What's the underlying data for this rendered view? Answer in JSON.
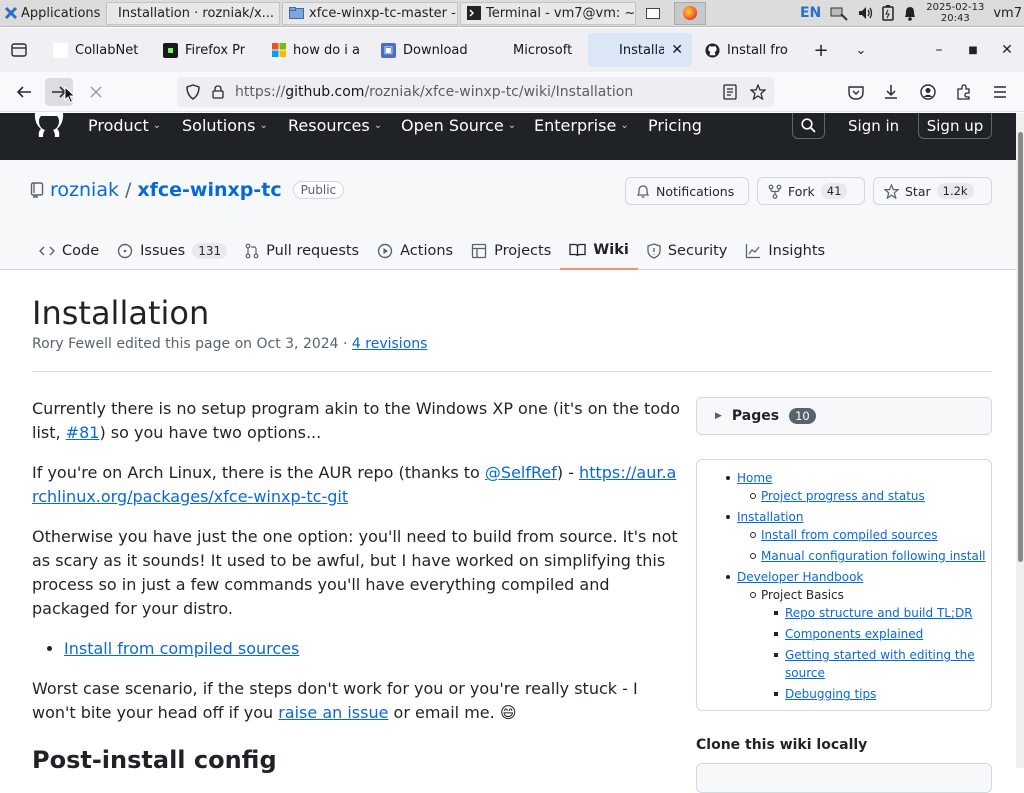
{
  "taskbar": {
    "apps_label": "Applications",
    "windows": [
      {
        "label": "Installation · rozniak/x...",
        "active": false
      },
      {
        "label": "xfce-winxp-tc-master -...",
        "active": false
      },
      {
        "label": "Terminal - vm7@vm: ~...",
        "active": false
      }
    ],
    "lang": "EN",
    "date": "2025-02-13",
    "time": "20:43",
    "user": "vm7"
  },
  "browser": {
    "tabs": [
      {
        "label": "CollabNet",
        "favicon": "page-icon"
      },
      {
        "label": "Firefox Pr",
        "favicon": "firefox-icon"
      },
      {
        "label": "how do i a",
        "favicon": "microsoft-icon"
      },
      {
        "label": "Download",
        "favicon": "download-icon"
      },
      {
        "label": "Microsoft",
        "favicon": "blank-icon"
      },
      {
        "label": "Installat",
        "favicon": "blank-icon",
        "active": true
      },
      {
        "label": "Install fro",
        "favicon": "github-icon"
      }
    ],
    "url_prefix": "https://",
    "url_host": "github.com",
    "url_path": "/rozniak/xfce-winxp-tc/wiki/Installation"
  },
  "github": {
    "nav": [
      {
        "label": "Product",
        "chevron": true
      },
      {
        "label": "Solutions",
        "chevron": true
      },
      {
        "label": "Resources",
        "chevron": true
      },
      {
        "label": "Open Source",
        "chevron": true
      },
      {
        "label": "Enterprise",
        "chevron": true
      },
      {
        "label": "Pricing",
        "chevron": false
      }
    ],
    "sign_in": "Sign in",
    "sign_up": "Sign up"
  },
  "repo": {
    "owner": "rozniak",
    "separator": "/",
    "name": "xfce-winxp-tc",
    "visibility": "Public",
    "notifications_label": "Notifications",
    "fork_label": "Fork",
    "fork_count": "41",
    "star_label": "Star",
    "star_count": "1.2k",
    "tabs": [
      {
        "label": "Code",
        "icon": "code-icon"
      },
      {
        "label": "Issues",
        "icon": "issue-icon",
        "count": "131"
      },
      {
        "label": "Pull requests",
        "icon": "pull-request-icon"
      },
      {
        "label": "Actions",
        "icon": "play-icon"
      },
      {
        "label": "Projects",
        "icon": "table-icon"
      },
      {
        "label": "Wiki",
        "icon": "book-icon",
        "selected": true
      },
      {
        "label": "Security",
        "icon": "shield-icon"
      },
      {
        "label": "Insights",
        "icon": "graph-icon"
      }
    ]
  },
  "page": {
    "title": "Installation",
    "meta_prefix": "Rory Fewell edited this page on Oct 3, 2024 · ",
    "revisions": "4 revisions",
    "p1_a": "Currently there is no setup program akin to the Windows XP one (it's on the todo list, ",
    "p1_link": "#81",
    "p1_b": ") so you have two options...",
    "p2_a": "If you're on Arch Linux, there is the AUR repo (thanks to ",
    "p2_link_user": "@SelfRef",
    "p2_b": ") - ",
    "p2_link_url": "https://aur.archlinux.org/packages/xfce-winxp-tc-git",
    "p3": "Otherwise you have just the one option: you'll need to build from source. It's not as scary as it sounds! It used to be awful, but I have worked on simplifying this process so in just a few commands you'll have everything compiled and packaged for your distro.",
    "list_link": "Install from compiled sources",
    "p4_a": "Worst case scenario, if the steps don't work for you or you're really stuck - I won't bite your head off if you ",
    "p4_link": "raise an issue",
    "p4_b": " or email me. ",
    "emoji": "😄",
    "h2": "Post-install config"
  },
  "sidebar": {
    "pages_label": "Pages",
    "pages_count": "10",
    "toc": {
      "home": "Home",
      "progress": "Project progress and status",
      "installation": "Installation",
      "install_compiled": "Install from compiled sources",
      "manual_config": "Manual configuration following install",
      "dev_handbook": "Developer Handbook",
      "project_basics": "Project Basics",
      "repo_structure": "Repo structure and build TL;DR",
      "components": "Components explained",
      "getting_started_1": "Getting started with editing the",
      "getting_started_2": "source",
      "debugging": "Debugging tips"
    },
    "clone_label": "Clone this wiki locally"
  }
}
